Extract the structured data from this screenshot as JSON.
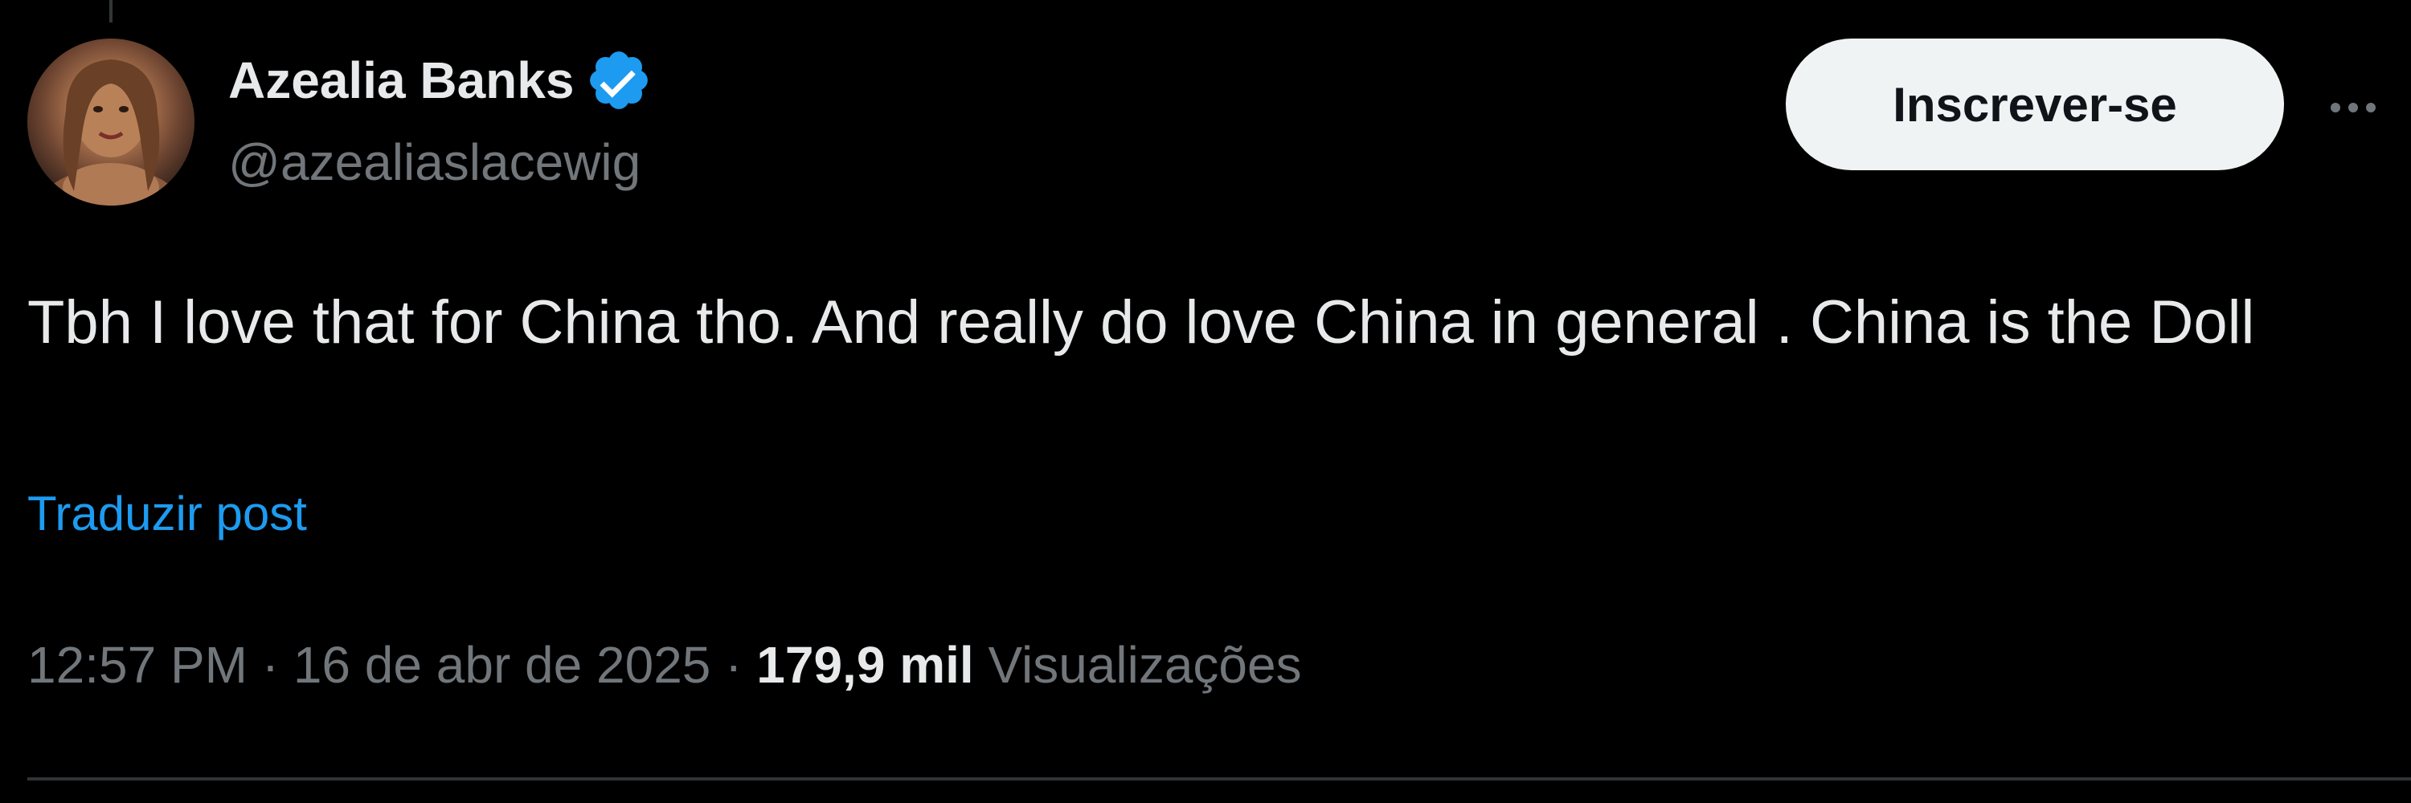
{
  "author": {
    "display_name": "Azealia Banks",
    "handle": "@azealiaslacewig",
    "verified": true,
    "avatar_icon": "profile-photo"
  },
  "actions": {
    "subscribe_label": "Inscrever-se",
    "more_icon": "ellipsis-icon"
  },
  "post": {
    "text": "Tbh I love that for China tho. And really do love China in general . China is the Doll",
    "translate_label": "Traduzir post"
  },
  "meta": {
    "time": "12:57 PM",
    "separator": "·",
    "date": "16 de abr de 2025",
    "views_count": "179,9 mil",
    "views_label": "Visualizações"
  },
  "colors": {
    "background": "#000000",
    "text_primary": "#e7e9ea",
    "text_secondary": "#71767b",
    "link": "#1d9bf0",
    "verified_badge": "#1d9bf0",
    "button_bg": "#eff3f4",
    "divider": "#2f3336"
  }
}
